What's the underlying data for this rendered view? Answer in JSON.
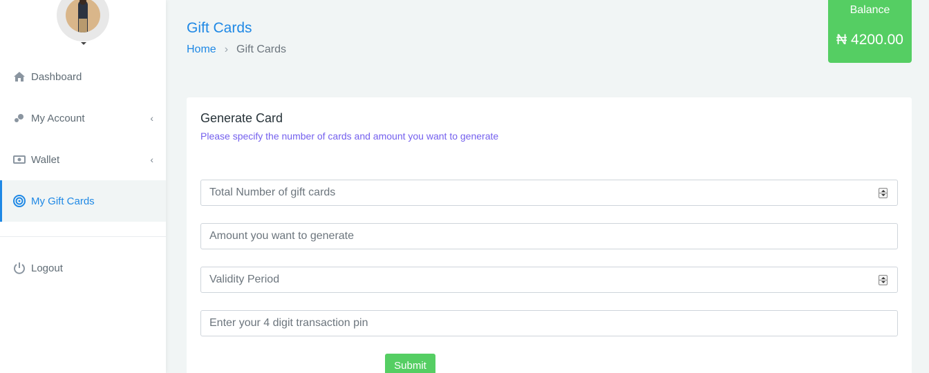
{
  "sidebar": {
    "items": [
      {
        "label": "Dashboard",
        "icon": "home-icon"
      },
      {
        "label": "My Account",
        "icon": "account-icon"
      },
      {
        "label": "Wallet",
        "icon": "wallet-icon"
      },
      {
        "label": "My Gift Cards",
        "icon": "target-icon"
      },
      {
        "label": "Logout",
        "icon": "power-icon"
      }
    ],
    "chevron": "‹"
  },
  "header": {
    "title": "Gift Cards",
    "breadcrumb": {
      "home": "Home",
      "separator": "›",
      "current": "Gift Cards"
    }
  },
  "balance": {
    "label": "Balance",
    "amount": "₦ 4200.00"
  },
  "card": {
    "title": "Generate Card",
    "subtitle": "Please specify the number of cards and amount you want to generate",
    "fields": {
      "num_cards": {
        "placeholder": "Total Number of gift cards"
      },
      "amount": {
        "placeholder": "Amount you want to generate"
      },
      "validity": {
        "placeholder": "Validity Period"
      },
      "pin": {
        "placeholder": "Enter your 4 digit transaction pin"
      }
    },
    "submit_label": "Submit"
  },
  "colors": {
    "accent": "#1e88e5",
    "success": "#55ce63",
    "subtitle": "#7460ee"
  }
}
